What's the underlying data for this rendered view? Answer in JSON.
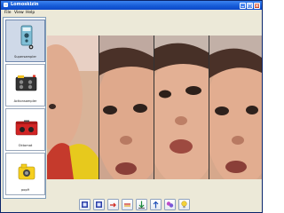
{
  "window": {
    "title": "Lomoskizin"
  },
  "menu": {
    "items": [
      "File",
      "View",
      "Help"
    ]
  },
  "sidebar": {
    "items": [
      {
        "label": "Supersampler",
        "selected": true
      },
      {
        "label": "Actionsampler",
        "selected": false
      },
      {
        "label": "Oktomat",
        "selected": false
      },
      {
        "label": "pop9",
        "selected": false
      }
    ]
  },
  "toolbar": {
    "buttons": [
      "frame-select-icon",
      "frame-select-icon",
      "rotate-icon",
      "flip-icon",
      "download-icon",
      "upload-icon",
      "color-icon",
      "lightbulb-icon"
    ]
  },
  "colors": {
    "title_bar": "#1459d6",
    "window_bg": "#ece9d8",
    "selected_tile": "#cfd9e8"
  }
}
